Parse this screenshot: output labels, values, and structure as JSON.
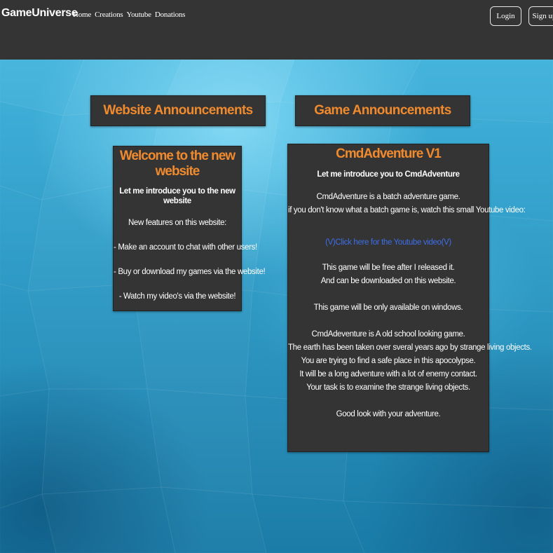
{
  "navbar": {
    "brand": "GameUniverse",
    "links": [
      "Home",
      "Creations",
      "Youtube",
      "Donations"
    ],
    "login_label": "Login",
    "signup_label": "Sign up"
  },
  "sections": {
    "website_title": "Website Announcements",
    "game_title": "Game Announcements"
  },
  "website_card": {
    "title": "Welcome to the new website",
    "subtitle": "Let me introduce you to the new website",
    "features_intro": "New features on this website:",
    "feature_1": "- Make an account to chat with other users!",
    "feature_2": "- Buy or download my games via the website!",
    "feature_3": "- Watch my video's via the website!"
  },
  "game_card": {
    "title": "CmdAdventure V1",
    "subtitle": "Let me introduce you to CmdAdventure",
    "desc_1": "CmdAdventure is a batch adventure game.",
    "desc_2": "if you don't know what a batch game is, watch this small Youtube video:",
    "video_link": "(V)Click here for the Youtube video(V)",
    "free_1": "This game will be free after I released it.",
    "free_2": "And can be downloaded on this website.",
    "windows": "This game will be only available on windows.",
    "story_1": "CmdAdeventure is A old school looking game.",
    "story_2": "The earth has been taken over sveral years ago by strange living objects.",
    "story_3": "You are trying to find a safe place in this apocolypse.",
    "story_4": "It will be a long adventure with a lot of enemy contact.",
    "story_5": "Your task is to examine the strange living objects.",
    "closing": "Good look with your adventure."
  },
  "colors": {
    "navbar_bg": "#343434",
    "card_bg": "#343434",
    "accent_orange": "#f08a2e",
    "link_blue": "#3d6ee8",
    "background_blue": "#2a98c4"
  }
}
